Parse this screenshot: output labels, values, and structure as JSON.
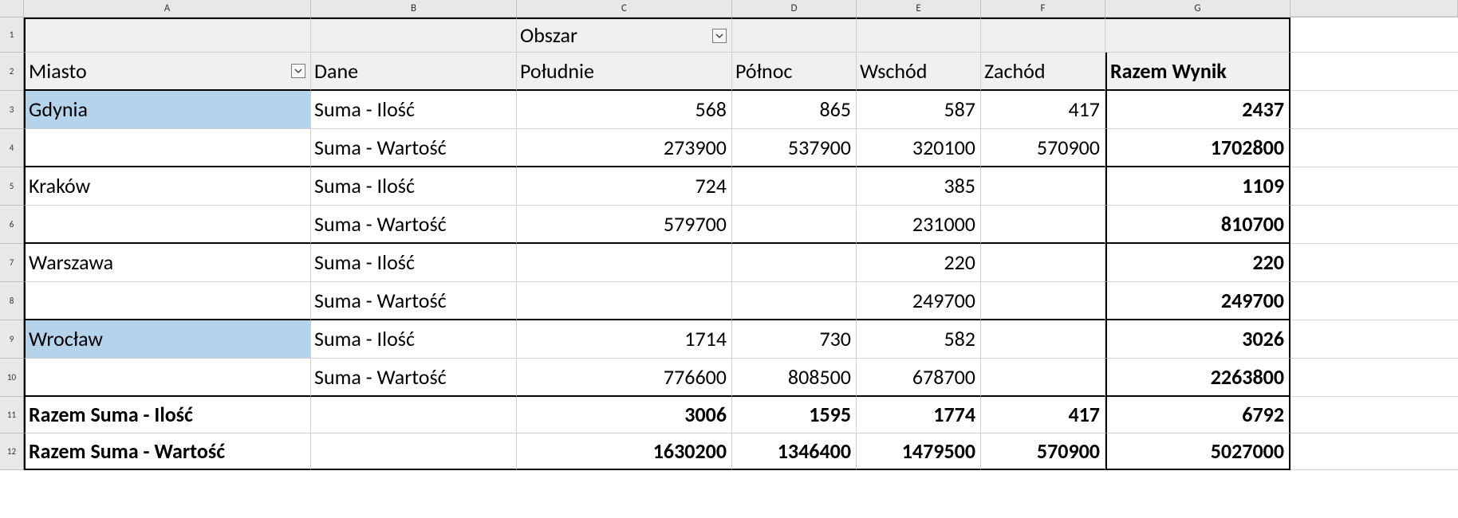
{
  "columns": [
    "A",
    "B",
    "C",
    "D",
    "E",
    "F",
    "G"
  ],
  "rownums": [
    "1",
    "2",
    "3",
    "4",
    "5",
    "6",
    "7",
    "8",
    "9",
    "10",
    "11",
    "12"
  ],
  "pivot": {
    "page_field_label": "Obszar",
    "row_field_label": "Miasto",
    "data_field_label": "Dane",
    "column_headers": [
      "Południe",
      "Północ",
      "Wschód",
      "Zachód"
    ],
    "grand_col_label": "Razem Wynik",
    "data_labels": {
      "qty": "Suma - Ilość",
      "val": "Suma - Wartość"
    },
    "rows": [
      {
        "city": "Gdynia",
        "selected": true,
        "qty": {
          "Południe": "568",
          "Północ": "865",
          "Wschód": "587",
          "Zachód": "417",
          "total": "2437"
        },
        "val": {
          "Południe": "273900",
          "Północ": "537900",
          "Wschód": "320100",
          "Zachód": "570900",
          "total": "1702800"
        }
      },
      {
        "city": "Kraków",
        "selected": false,
        "qty": {
          "Południe": "724",
          "Północ": "",
          "Wschód": "385",
          "Zachód": "",
          "total": "1109"
        },
        "val": {
          "Południe": "579700",
          "Północ": "",
          "Wschód": "231000",
          "Zachód": "",
          "total": "810700"
        }
      },
      {
        "city": "Warszawa",
        "selected": false,
        "qty": {
          "Południe": "",
          "Północ": "",
          "Wschód": "220",
          "Zachód": "",
          "total": "220"
        },
        "val": {
          "Południe": "",
          "Północ": "",
          "Wschód": "249700",
          "Zachód": "",
          "total": "249700"
        }
      },
      {
        "city": "Wrocław",
        "selected": true,
        "qty": {
          "Południe": "1714",
          "Północ": "730",
          "Wschód": "582",
          "Zachód": "",
          "total": "3026"
        },
        "val": {
          "Południe": "776600",
          "Północ": "808500",
          "Wschód": "678700",
          "Zachód": "",
          "total": "2263800"
        }
      }
    ],
    "grand_totals": {
      "qty_label": "Razem Suma - Ilość",
      "val_label": "Razem Suma - Wartość",
      "qty": {
        "Południe": "3006",
        "Północ": "1595",
        "Wschód": "1774",
        "Zachód": "417",
        "total": "6792"
      },
      "val": {
        "Południe": "1630200",
        "Północ": "1346400",
        "Wschód": "1479500",
        "Zachód": "570900",
        "total": "5027000"
      }
    }
  }
}
